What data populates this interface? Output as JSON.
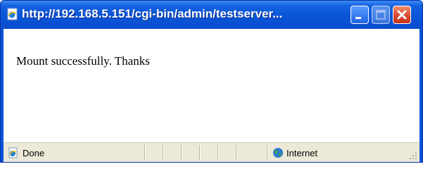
{
  "window": {
    "title": "http://192.168.5.151/cgi-bin/admin/testserver...",
    "icon": "ie-page-icon"
  },
  "content": {
    "message": "Mount successfully. Thanks"
  },
  "statusbar": {
    "status_text": "Done",
    "status_icon": "ie-page-done-icon",
    "zone_text": "Internet",
    "zone_icon": "globe-icon"
  },
  "colors": {
    "titlebar": "#0a55d8",
    "close_button": "#d6452a",
    "statusbar": "#ece9d8"
  }
}
